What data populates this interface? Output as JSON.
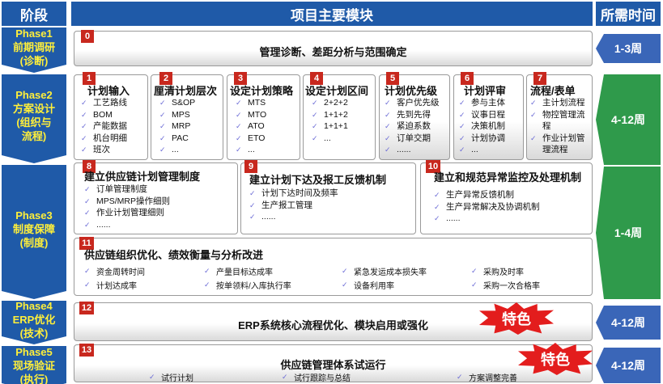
{
  "header": {
    "stage": "阶段",
    "modules": "项目主要模块",
    "duration": "所需时间"
  },
  "phases": [
    {
      "l1": "Phase1",
      "l2": "前期调研",
      "l3": "(诊断)",
      "l4": ""
    },
    {
      "l1": "Phase2",
      "l2": "方案设计",
      "l3": "(组织与",
      "l4": "流程)"
    },
    {
      "l1": "Phase3",
      "l2": "制度保障",
      "l3": "(制度)",
      "l4": ""
    },
    {
      "l1": "Phase4",
      "l2": "ERP优化",
      "l3": "(技术)",
      "l4": ""
    },
    {
      "l1": "Phase5",
      "l2": "现场验证",
      "l3": "(执行)",
      "l4": ""
    }
  ],
  "durations": [
    "1-3周",
    "4-12周",
    "1-4周",
    "4-12周",
    "4-12周"
  ],
  "modules": {
    "m0": {
      "num": "0",
      "title": "管理诊断、差距分析与范围确定"
    },
    "m1": {
      "num": "1",
      "title": "计划输入",
      "items": [
        "工艺路线",
        "BOM",
        "产能数据",
        "机台明细",
        "班次",
        "......"
      ]
    },
    "m2": {
      "num": "2",
      "title": "厘清计划层次",
      "items": [
        "S&OP",
        "MPS",
        "MRP",
        "PAC",
        "..."
      ]
    },
    "m3": {
      "num": "3",
      "title": "设定计划策略",
      "items": [
        "MTS",
        "MTO",
        "ATO",
        "ETO",
        "..."
      ]
    },
    "m4": {
      "num": "4",
      "title": "设定计划区间",
      "items": [
        "2+2+2",
        "1+1+2",
        "1+1+1",
        "..."
      ]
    },
    "m5": {
      "num": "5",
      "title": "计划优先级",
      "items": [
        "客户优先级",
        "先到先得",
        "紧迫系数",
        "订单交期",
        "......"
      ]
    },
    "m6": {
      "num": "6",
      "title": "计划评审",
      "items": [
        "参与主体",
        "议事日程",
        "决策机制",
        "计划协调",
        "..."
      ]
    },
    "m7": {
      "num": "7",
      "title": "流程/表单",
      "items": [
        "主计划流程",
        "物控管理流",
        "程",
        "作业计划管",
        "理流程"
      ]
    },
    "m8": {
      "num": "8",
      "title": "建立供应链计划管理制度",
      "items": [
        "订单管理制度",
        "MPS/MRP操作细则",
        "作业计划管理细则",
        "......"
      ]
    },
    "m9": {
      "num": "9",
      "title": "建立计划下达及报工反馈机制",
      "items": [
        "计划下达时间及频率",
        "生产报工管理",
        "......"
      ]
    },
    "m10": {
      "num": "10",
      "title": "建立和规范异常监控及处理机制",
      "items": [
        "生产异常反馈机制",
        "生产异常解决及协调机制",
        "......"
      ]
    },
    "m11": {
      "num": "11",
      "title": "供应链组织优化、绩效衡量与分析改进",
      "row1": [
        "资金周转时间",
        "产量目标达成率",
        "紧急发运成本损失率",
        "采购及时率"
      ],
      "row2": [
        "计划达成率",
        "按单领料/入库执行率",
        "设备利用率",
        "采购一次合格率"
      ]
    },
    "m12": {
      "num": "12",
      "title": "ERP系统核心流程优化、模块启用或强化"
    },
    "m13": {
      "num": "13",
      "title": "供应链管理体系试运行",
      "items": [
        "试行计划",
        "试行跟踪与总结",
        "方案调整完善"
      ]
    }
  },
  "feature_label": "特色",
  "colors": {
    "header_blue": "#1f5aa8",
    "phase_text": "#ffef3a",
    "duration_blue": "#3a66b8",
    "duration_green": "#2f9a4b",
    "number_red": "#c8281e",
    "feature_red": "#e31d1d"
  }
}
